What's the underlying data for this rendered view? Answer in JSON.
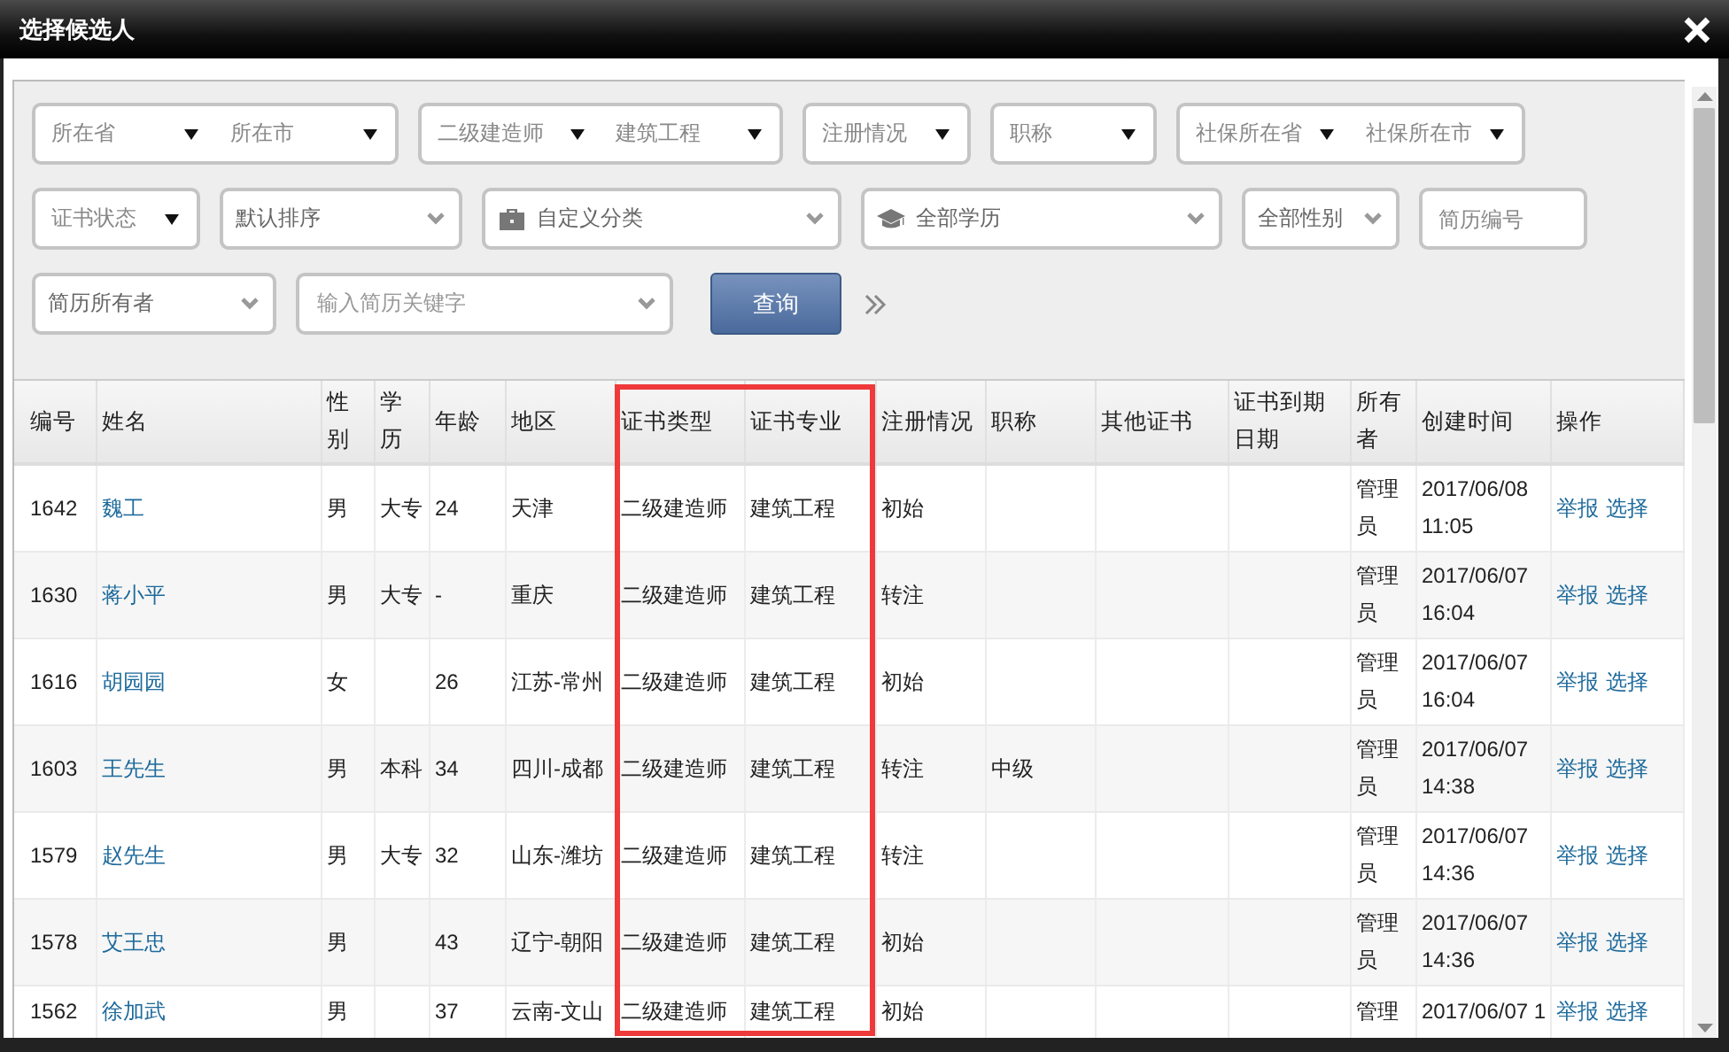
{
  "window": {
    "title": "选择候选人"
  },
  "filters": [
    [
      {
        "kind": "dual",
        "parts": [
          "所在省",
          "所在市"
        ]
      },
      {
        "kind": "dual",
        "parts": [
          "二级建造师",
          "建筑工程"
        ]
      },
      {
        "kind": "select",
        "label": "注册情况"
      },
      {
        "kind": "select",
        "label": "职称"
      },
      {
        "kind": "dual",
        "parts": [
          "社保所在省",
          "社保所在市"
        ]
      }
    ],
    [
      {
        "kind": "select",
        "label": "证书状态"
      },
      {
        "kind": "dropdown",
        "label": "默认排序"
      },
      {
        "kind": "dropdown",
        "label": "自定义分类"
      },
      {
        "kind": "dropdown",
        "label": "全部学历"
      },
      {
        "kind": "dropdown",
        "label": "全部性别"
      },
      {
        "kind": "input",
        "placeholder": "简历编号"
      }
    ],
    [
      {
        "kind": "dropdown",
        "label": "简历所有者"
      },
      {
        "kind": "dropdown",
        "placeholder": "输入简历关键字"
      },
      {
        "kind": "button",
        "label": "查询"
      },
      {
        "kind": "more"
      }
    ]
  ],
  "table": {
    "columns": [
      {
        "label": "编号",
        "highlighted": false
      },
      {
        "label": "姓名",
        "highlighted": false
      },
      {
        "label": "性别",
        "highlighted": false
      },
      {
        "label": "学历",
        "highlighted": false
      },
      {
        "label": "年龄",
        "highlighted": false
      },
      {
        "label": "地区",
        "highlighted": false
      },
      {
        "label": "证书类型",
        "highlighted": true
      },
      {
        "label": "证书专业",
        "highlighted": true
      },
      {
        "label": "注册情况",
        "highlighted": false
      },
      {
        "label": "职称",
        "highlighted": false
      },
      {
        "label": "其他证书",
        "highlighted": false
      },
      {
        "label": "证书到期日期",
        "highlighted": false
      },
      {
        "label": "所有者",
        "highlighted": false
      },
      {
        "label": "创建时间",
        "highlighted": false
      },
      {
        "label": "操作",
        "highlighted": false
      }
    ],
    "rows": [
      {
        "id": "1642",
        "name": "魏工",
        "gender": "男",
        "education": "大专",
        "age": "24",
        "region": "天津",
        "cert_type": "二级建造师",
        "cert_major": "建筑工程",
        "registration": "初始",
        "owner": "管理员",
        "created": "2017/06/08 11:05",
        "actions": [
          "举报",
          "选择"
        ]
      },
      {
        "id": "1630",
        "name": "蒋小平",
        "gender": "男",
        "education": "大专",
        "age": "-",
        "region": "重庆",
        "cert_type": "二级建造师",
        "cert_major": "建筑工程",
        "registration": "转注",
        "owner": "管理员",
        "created": "2017/06/07 16:04",
        "actions": [
          "举报",
          "选择"
        ]
      },
      {
        "id": "1616",
        "name": "胡园园",
        "gender": "女",
        "age": "26",
        "region": "江苏-常州",
        "cert_type": "二级建造师",
        "cert_major": "建筑工程",
        "registration": "初始",
        "owner": "管理员",
        "created": "2017/06/07 16:04",
        "actions": [
          "举报",
          "选择"
        ]
      },
      {
        "id": "1603",
        "name": "王先生",
        "gender": "男",
        "education": "本科",
        "age": "34",
        "region": "四川-成都",
        "cert_type": "二级建造师",
        "cert_major": "建筑工程",
        "registration": "转注",
        "title": "中级",
        "owner": "管理员",
        "created": "2017/06/07 14:38",
        "actions": [
          "举报",
          "选择"
        ]
      },
      {
        "id": "1579",
        "name": "赵先生",
        "gender": "男",
        "education": "大专",
        "age": "32",
        "region": "山东-潍坊",
        "cert_type": "二级建造师",
        "cert_major": "建筑工程",
        "registration": "转注",
        "owner": "管理员",
        "created": "2017/06/07 14:36",
        "actions": [
          "举报",
          "选择"
        ]
      },
      {
        "id": "1578",
        "name": "艾王忠",
        "gender": "男",
        "age": "43",
        "region": "辽宁-朝阳",
        "cert_type": "二级建造师",
        "cert_major": "建筑工程",
        "registration": "初始",
        "owner": "管理员",
        "created": "2017/06/07 14:36",
        "actions": [
          "举报",
          "选择"
        ]
      },
      {
        "id": "1562",
        "name": "徐加武",
        "gender": "男",
        "age": "37",
        "region": "云南-文山",
        "cert_type": "二级建造师",
        "cert_major": "建筑工程",
        "registration": "初始",
        "owner": "管理",
        "created": "2017/06/07 1",
        "actions": [
          "举报",
          "选择"
        ]
      }
    ]
  }
}
